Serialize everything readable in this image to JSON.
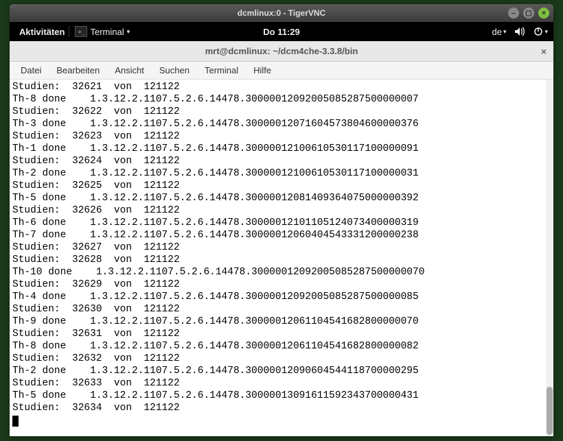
{
  "vnc": {
    "title": "dcmlinux:0 - TigerVNC"
  },
  "gnome": {
    "activities": "Aktivitäten",
    "app_name": "Terminal",
    "clock": "Do 11:29",
    "lang": "de"
  },
  "terminal": {
    "title": "mrt@dcmlinux: ~/dcm4che-3.3.8/bin",
    "menu": {
      "file": "Datei",
      "edit": "Bearbeiten",
      "view": "Ansicht",
      "search": "Suchen",
      "terminal": "Terminal",
      "help": "Hilfe"
    },
    "lines": [
      "Studien:  32621  von  121122",
      "Th-8 done    1.3.12.2.1107.5.2.6.14478.30000012092005085287500000007",
      "Studien:  32622  von  121122",
      "Th-3 done    1.3.12.2.1107.5.2.6.14478.30000012071604573804600000376",
      "Studien:  32623  von  121122",
      "Th-1 done    1.3.12.2.1107.5.2.6.14478.30000012100610530117100000091",
      "Studien:  32624  von  121122",
      "Th-2 done    1.3.12.2.1107.5.2.6.14478.30000012100610530117100000031",
      "Studien:  32625  von  121122",
      "Th-5 done    1.3.12.2.1107.5.2.6.14478.30000012081409364075000000392",
      "Studien:  32626  von  121122",
      "Th-6 done    1.3.12.2.1107.5.2.6.14478.30000012101105124073400000319",
      "Th-7 done    1.3.12.2.1107.5.2.6.14478.30000012060404543331200000238",
      "Studien:  32627  von  121122",
      "Studien:  32628  von  121122",
      "Th-10 done    1.3.12.2.1107.5.2.6.14478.30000012092005085287500000070",
      "Studien:  32629  von  121122",
      "Th-4 done    1.3.12.2.1107.5.2.6.14478.30000012092005085287500000085",
      "Studien:  32630  von  121122",
      "Th-9 done    1.3.12.2.1107.5.2.6.14478.30000012061104541682800000070",
      "Studien:  32631  von  121122",
      "Th-8 done    1.3.12.2.1107.5.2.6.14478.30000012061104541682800000082",
      "Studien:  32632  von  121122",
      "Th-2 done    1.3.12.2.1107.5.2.6.14478.30000012090604544118700000295",
      "Studien:  32633  von  121122",
      "Th-5 done    1.3.12.2.1107.5.2.6.14478.30000013091611592343700000431",
      "Studien:  32634  von  121122"
    ]
  }
}
